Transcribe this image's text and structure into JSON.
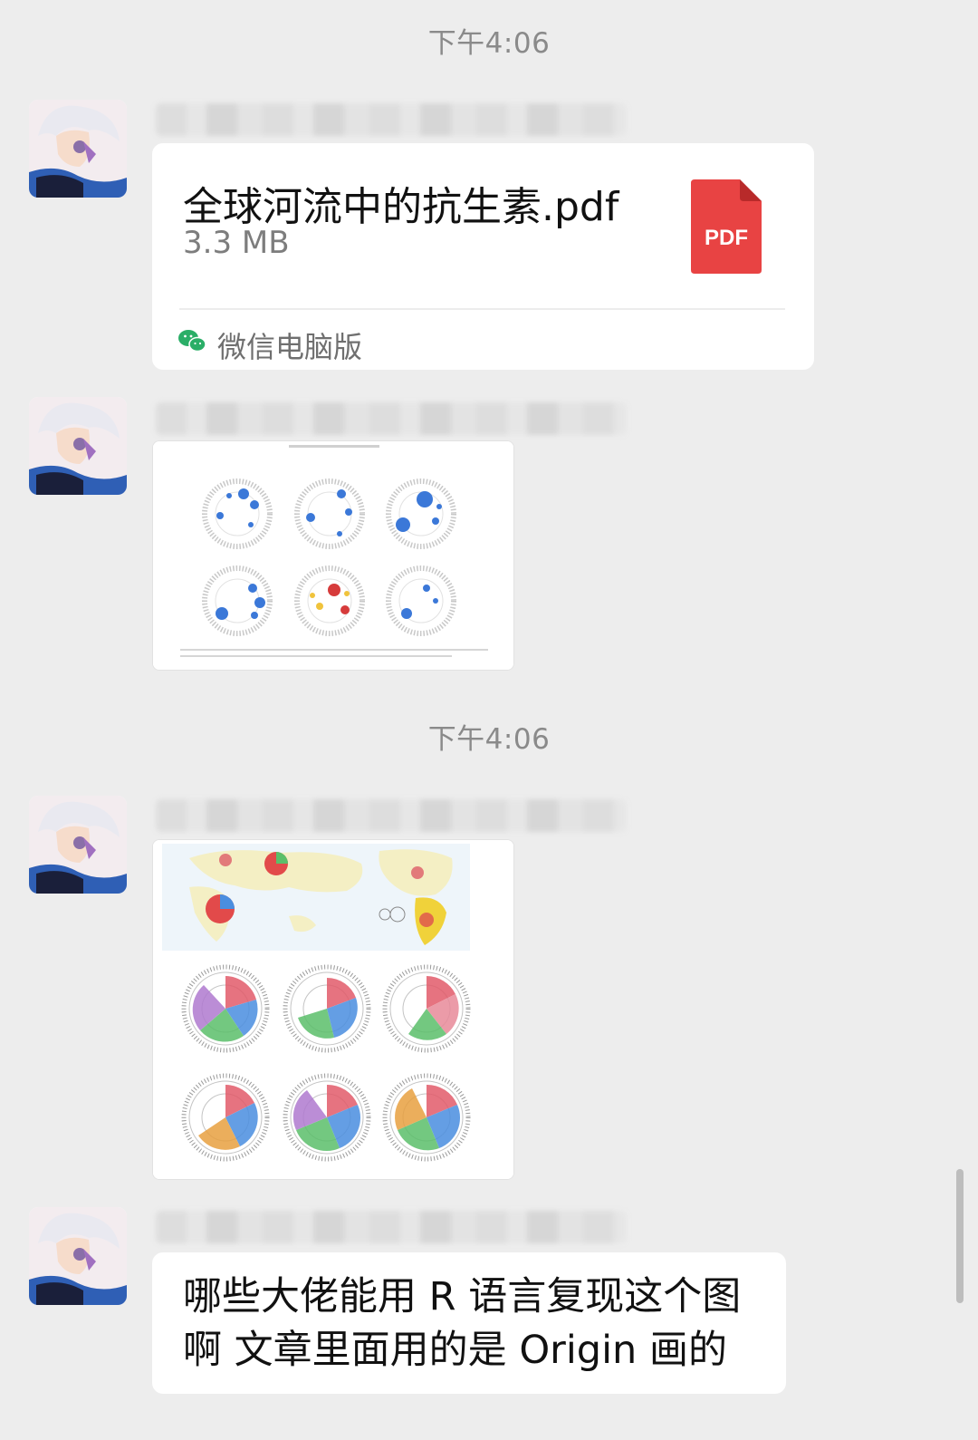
{
  "timestamps": [
    "下午4:06",
    "下午4:06"
  ],
  "file_message": {
    "file_name": "全球河流中的抗生素.pdf",
    "file_size": "3.3 MB",
    "file_type_badge": "PDF",
    "source_label": "微信电脑版"
  },
  "text_message": {
    "line1": "哪些大佬能用 R 语言复现这个图",
    "line2": "啊  文章里面用的是 Origin 画的"
  },
  "colors": {
    "background": "#ededed",
    "bubble": "#ffffff",
    "pdf_red": "#e84343",
    "wechat_green": "#2aae67",
    "timestamp": "#8a8a8a"
  },
  "icons": [
    "avatar",
    "pdf-file-icon",
    "wechat-icon"
  ]
}
